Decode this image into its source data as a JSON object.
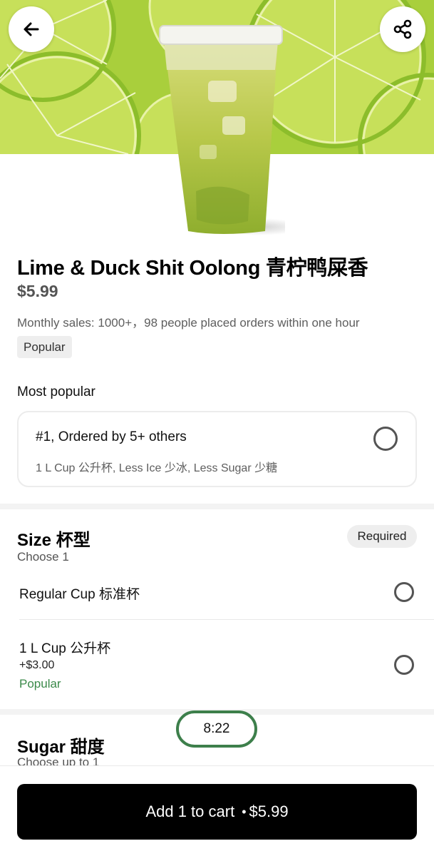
{
  "header": {
    "back_icon": "arrow-left-icon",
    "share_icon": "share-icon"
  },
  "product": {
    "title": "Lime & Duck Shit Oolong 青柠鸭屎香",
    "price": "$5.99",
    "sales_text": "Monthly sales: 1000+，98 people placed orders within one hour",
    "tag": "Popular",
    "colors": {
      "lime": "#b9d84f",
      "drink": "#b8c84a"
    }
  },
  "most_popular": {
    "heading": "Most popular",
    "card": {
      "title": "#1, Ordered by 5+ others",
      "subtitle": "1 L Cup 公升杯, Less Ice 少冰, Less Sugar 少糖",
      "selected": false
    }
  },
  "size": {
    "heading": "Size 杯型",
    "sub": "Choose 1",
    "badge": "Required",
    "options": [
      {
        "label": "Regular Cup 标准杯",
        "price": "",
        "tag": "",
        "selected": false
      },
      {
        "label": "1 L Cup 公升杯",
        "price": "+$3.00",
        "tag": "Popular",
        "selected": false
      }
    ]
  },
  "sugar": {
    "heading": "Sugar 甜度",
    "sub": "Choose up to 1"
  },
  "overlay": {
    "time": "8:22",
    "accent": "#3d7f4b"
  },
  "footer": {
    "cart_label": "Add 1 to cart",
    "separator": "•",
    "cart_price": "$5.99"
  }
}
